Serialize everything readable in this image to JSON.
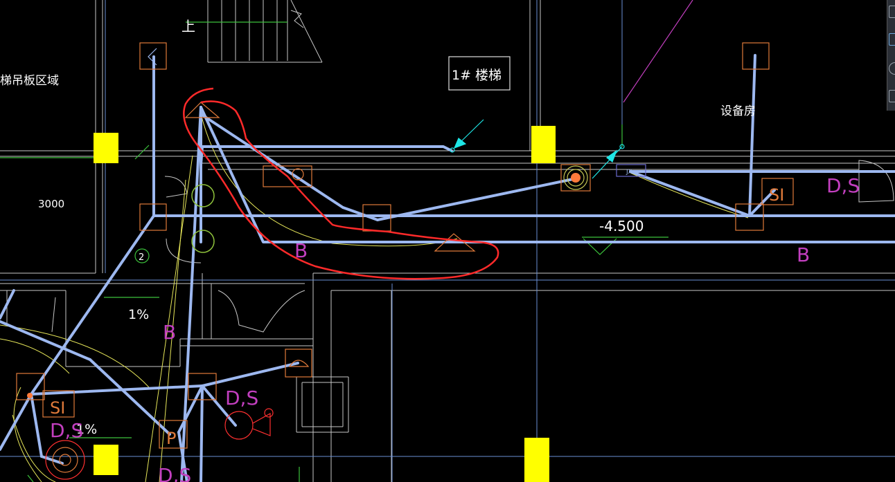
{
  "labels": {
    "stair_area": "梯吊板区域",
    "dimension": "3000",
    "up_mark": "上",
    "stair_tag": "1# 楼梯",
    "equipment_room": "设备房",
    "elevation": "-4.500",
    "grid_no": "2",
    "slope_a": "1%",
    "slope_b": "1%",
    "pipe_b1": "B",
    "pipe_b2": "B",
    "pipe_b3": "B",
    "pipe_ds1": "D,S",
    "pipe_ds2": "D,S",
    "pipe_ds3": "D,S",
    "pipe_ds4": "D,S",
    "pipe_si1": "SI",
    "pipe_si2": "SI",
    "pipe_p": "P",
    "pipe_jx": "JX"
  },
  "colors": {
    "background": "#000000",
    "pipe": "#9db8f0",
    "wall": "#c8c8c8",
    "grid": "#6a8fd6",
    "fixture": "#e07a3a",
    "highlight": "#ff2a2a",
    "marker": "#ffff00",
    "annotation": "#c23fbf",
    "leader": "#1ee6e6",
    "green": "#3cc33c",
    "yellow_line": "#e8e85a"
  },
  "icons": {
    "toolbar": [
      "cube-icon",
      "cube-outline-icon",
      "circle-icon",
      "layers-icon"
    ]
  }
}
